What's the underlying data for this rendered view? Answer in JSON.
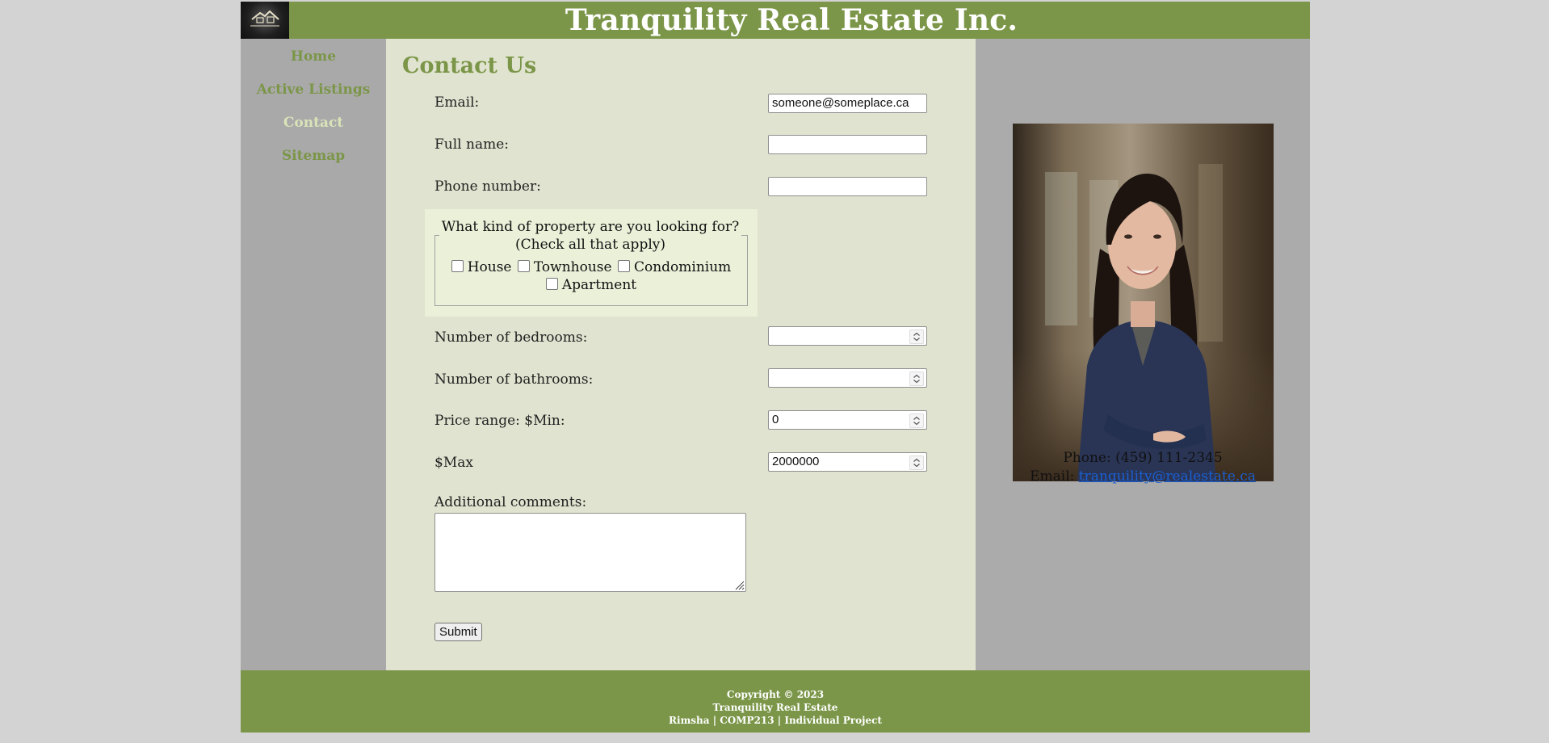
{
  "header": {
    "title": "Tranquility Real Estate Inc.",
    "logo_icon": "real-estate-house-logo",
    "logo_text": "REAL ESTATE"
  },
  "nav": {
    "items": [
      {
        "label": "Home",
        "active": false
      },
      {
        "label": "Active Listings",
        "active": false
      },
      {
        "label": "Contact",
        "active": true
      },
      {
        "label": "Sitemap",
        "active": false
      }
    ]
  },
  "form": {
    "heading": "Contact Us",
    "email": {
      "label": "Email:",
      "value": "someone@someplace.ca"
    },
    "full_name": {
      "label": "Full name:",
      "value": ""
    },
    "phone": {
      "label": "Phone number:",
      "value": ""
    },
    "property": {
      "legend_line1": "What kind of property are you looking for?",
      "legend_line2": "(Check all that apply)",
      "options": [
        "House",
        "Townhouse",
        "Condominium",
        "Apartment"
      ]
    },
    "bedrooms": {
      "label": "Number of bedrooms:",
      "value": ""
    },
    "bathrooms": {
      "label": "Number of bathrooms:",
      "value": ""
    },
    "price_min": {
      "label": "Price range: $Min:",
      "value": "0"
    },
    "price_max": {
      "label": "$Max",
      "value": "2000000"
    },
    "comments": {
      "label": "Additional comments:",
      "value": ""
    },
    "submit_label": "Submit"
  },
  "contact": {
    "phone_text": "Phone: (459) 111-2345",
    "email_label": "Email:",
    "email_link": "tranquility@realestate.ca"
  },
  "footer": {
    "line1": "Copyright © 2023",
    "line2": "Tranquility Real Estate",
    "line3": "Rimsha | COMP213 | Individual Project"
  },
  "colors": {
    "brand_green": "#7b9648",
    "main_bg": "#e0e3cf",
    "sidebar_bg": "#a9a9a9",
    "link_blue": "#1a5fd2"
  }
}
